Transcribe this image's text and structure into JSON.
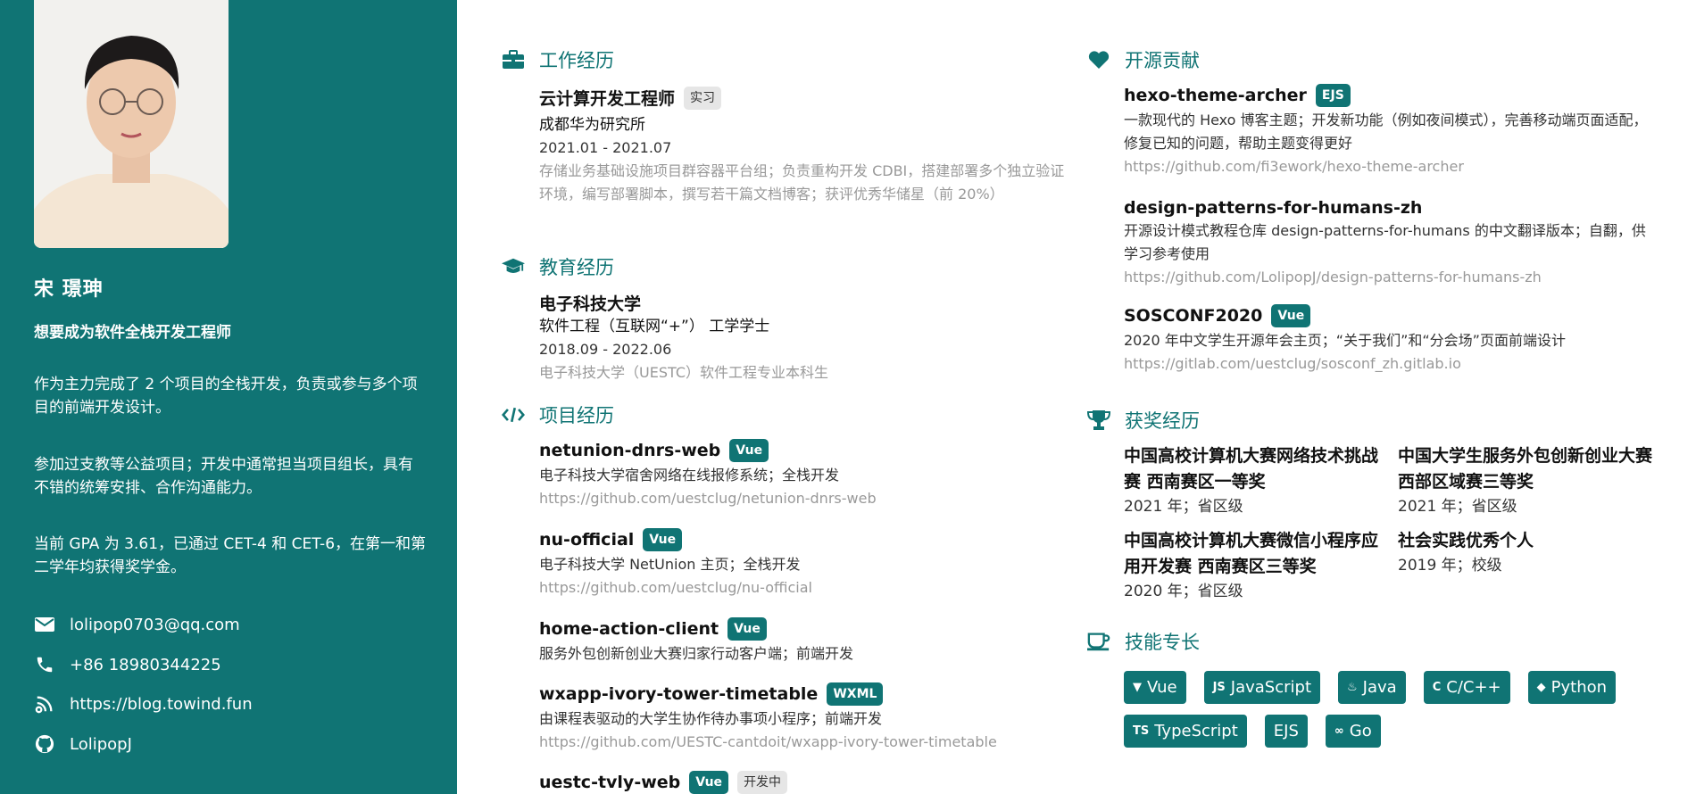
{
  "profile": {
    "name": "宋 璟珅",
    "motto": "想要成为软件全栈开发工程师",
    "paragraphs": [
      "作为主力完成了 2 个项目的全栈开发，负责或参与多个项目的前端开发设计。",
      "参加过支教等公益项目；开发中通常担当项目组长，具有不错的统筹安排、合作沟通能力。",
      "当前 GPA 为 3.61，已通过 CET-4 和 CET-6，在第一和第二学年均获得奖学金。"
    ],
    "contacts": [
      {
        "icon": "envelope-icon",
        "text": "lolipop0703@qq.com"
      },
      {
        "icon": "phone-icon",
        "text": "+86 18980344225"
      },
      {
        "icon": "blog-icon",
        "text": "https://blog.towind.fun"
      },
      {
        "icon": "github-icon",
        "text": "LolipopJ"
      }
    ]
  },
  "work": {
    "heading": "工作经历",
    "title": "云计算开发工程师",
    "badge": "实习",
    "company": "成都华为研究所",
    "period": "2021.01 - 2021.07",
    "desc": "存储业务基础设施项目群容器平台组；负责重构开发 CDBI，搭建部署多个独立验证环境，编写部署脚本，撰写若干篇文档博客；获评优秀华储星（前 20%）"
  },
  "education": {
    "heading": "教育经历",
    "school": "电子科技大学",
    "degree": "软件工程（互联网“+”） 工学学士",
    "period": "2018.09 - 2022.06",
    "desc": "电子科技大学（UESTC）软件工程专业本科生"
  },
  "projects": {
    "heading": "项目经历",
    "items": [
      {
        "name": "netunion-dnrs-web",
        "badge": "Vue",
        "desc": "电子科技大学宿舍网络在线报修系统；全栈开发",
        "link": "https://github.com/uestclug/netunion-dnrs-web"
      },
      {
        "name": "nu-official",
        "badge": "Vue",
        "desc": "电子科技大学 NetUnion 主页；全栈开发",
        "link": "https://github.com/uestclug/nu-official"
      },
      {
        "name": "home-action-client",
        "badge": "Vue",
        "desc": "服务外包创新创业大赛归家行动客户端；前端开发",
        "link": ""
      },
      {
        "name": "wxapp-ivory-tower-timetable",
        "badge": "WXML",
        "desc": "由课程表驱动的大学生协作待办事项小程序；前端开发",
        "link": "https://github.com/UESTC-cantdoit/wxapp-ivory-tower-timetable"
      },
      {
        "name": "uestc-tvly-web",
        "badge": "Vue",
        "badge2": "开发中"
      }
    ]
  },
  "opensource": {
    "heading": "开源贡献",
    "items": [
      {
        "name": "hexo-theme-archer",
        "badge": "EJS",
        "desc": "一款现代的 Hexo 博客主题；开发新功能（例如夜间模式），完善移动端页面适配，修复已知的问题，帮助主题变得更好",
        "link": "https://github.com/fi3ework/hexo-theme-archer"
      },
      {
        "name": "design-patterns-for-humans-zh",
        "badge": "",
        "desc": "开源设计模式教程仓库 design-patterns-for-humans 的中文翻译版本；自翻，供学习参考使用",
        "link": "https://github.com/LolipopJ/design-patterns-for-humans-zh"
      },
      {
        "name": "SOSCONF2020",
        "badge": "Vue",
        "desc": "2020 年中文学生开源年会主页；“关于我们”和“分会场”页面前端设计",
        "link": "https://gitlab.com/uestclug/sosconf_zh.gitlab.io"
      }
    ]
  },
  "awards": {
    "heading": "获奖经历",
    "items": [
      {
        "title": "中国高校计算机大赛网络技术挑战赛 西南赛区一等奖",
        "sub": "2021 年；省区级"
      },
      {
        "title": "中国大学生服务外包创新创业大赛 西部区域赛三等奖",
        "sub": "2021 年；省区级"
      },
      {
        "title": "中国高校计算机大赛微信小程序应用开发赛 西南赛区三等奖",
        "sub": "2020 年；省区级"
      },
      {
        "title": "社会实践优秀个人",
        "sub": "2019 年；校级"
      }
    ]
  },
  "skills": {
    "heading": "技能专长",
    "items": [
      {
        "icon": "vue-icon",
        "glyph": "▼",
        "label": "Vue"
      },
      {
        "icon": "javascript-icon",
        "glyph": "JS",
        "label": "JavaScript"
      },
      {
        "icon": "java-icon",
        "glyph": "♨",
        "label": "Java"
      },
      {
        "icon": "c-icon",
        "glyph": "C",
        "label": "C/C++"
      },
      {
        "icon": "python-icon",
        "glyph": "◆",
        "label": "Python"
      },
      {
        "icon": "typescript-icon",
        "glyph": "TS",
        "label": "TypeScript"
      },
      {
        "icon": "",
        "glyph": "",
        "label": "EJS"
      },
      {
        "icon": "go-icon",
        "glyph": "∞",
        "label": "Go"
      }
    ]
  },
  "colors": {
    "accent": "#107474"
  }
}
